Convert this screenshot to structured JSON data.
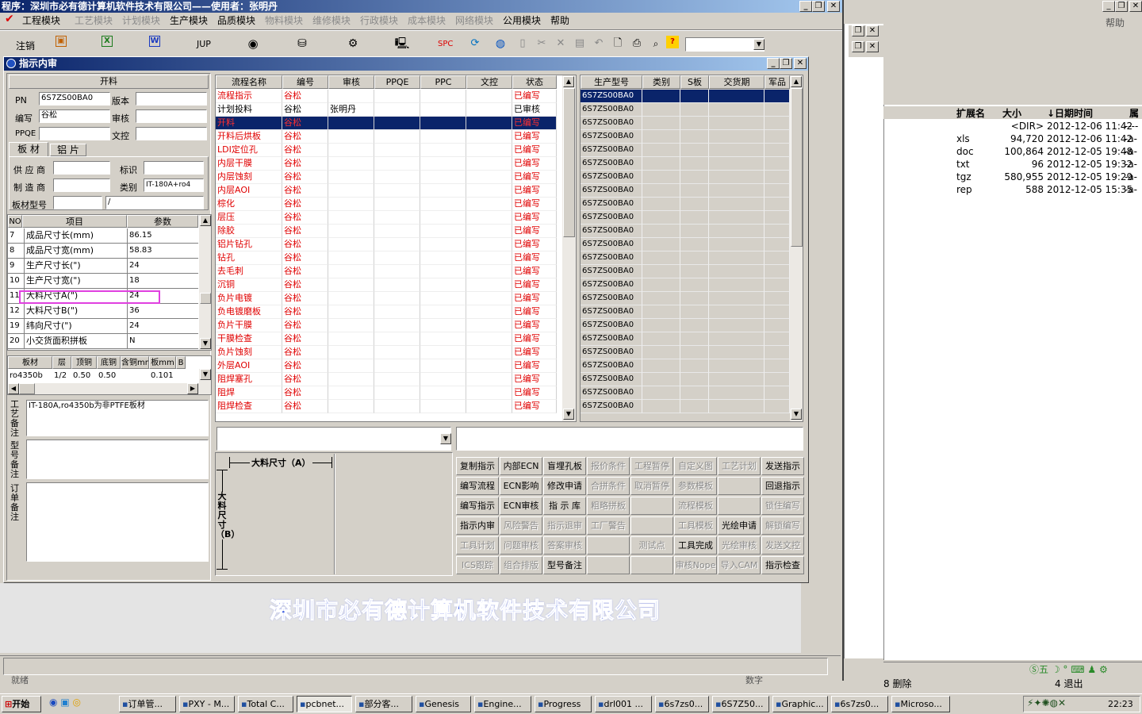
{
  "app": {
    "title": "程序：深圳市必有德计算机软件技术有限公司——使用者：张明丹",
    "menus": [
      {
        "label": "工程模块",
        "enabled": true
      },
      {
        "label": "工艺模块",
        "enabled": false
      },
      {
        "label": "计划模块",
        "enabled": false
      },
      {
        "label": "生产模块",
        "enabled": true
      },
      {
        "label": "品质模块",
        "enabled": true
      },
      {
        "label": "物料模块",
        "enabled": false
      },
      {
        "label": "维修模块",
        "enabled": false
      },
      {
        "label": "行政模块",
        "enabled": false
      },
      {
        "label": "成本模块",
        "enabled": false
      },
      {
        "label": "网络模块",
        "enabled": false
      },
      {
        "label": "公用模块",
        "enabled": true
      },
      {
        "label": "帮助",
        "enabled": true
      }
    ],
    "toolbar": {
      "logout": "注销",
      "jup": "JUP",
      "spc": "SPC"
    },
    "company_banner": "深圳市必有德计算机软件技术有限公司",
    "status_left": "就绪",
    "status_right": "数字"
  },
  "dialog": {
    "title": "指示内审",
    "left": {
      "section_title": "开料",
      "pn_label": "PN",
      "pn_value": "6S7ZS00BA0",
      "version_label": "版本",
      "writer_label": "编写",
      "writer_value": "谷松",
      "review_label": "审核",
      "ppqe_label": "PPQE",
      "control_label": "文控",
      "tabs": [
        "板 材",
        "铝 片"
      ],
      "supplier_label": "供 应 商",
      "mark_label": "标识",
      "maker_label": "制 造 商",
      "category_label": "类别",
      "category_value": "IT-180A+ro4",
      "board_model_label": "板材型号",
      "board_model_value": "/",
      "param_headers": [
        "NO",
        "项目",
        "参数"
      ],
      "params": [
        {
          "no": "7",
          "item": "成品尺寸长(mm)",
          "value": "86.15"
        },
        {
          "no": "8",
          "item": "成品尺寸宽(mm)",
          "value": "58.83"
        },
        {
          "no": "9",
          "item": "生产尺寸长(\")",
          "value": "24"
        },
        {
          "no": "10",
          "item": "生产尺寸宽(\")",
          "value": "18"
        },
        {
          "no": "11",
          "item": "大料尺寸A(\")",
          "value": "24"
        },
        {
          "no": "12",
          "item": "大料尺寸B(\")",
          "value": "36"
        },
        {
          "no": "19",
          "item": "纬向尺寸(\")",
          "value": "24"
        },
        {
          "no": "20",
          "item": "小交货面积拼板",
          "value": "N"
        }
      ],
      "board_headers": [
        "板材",
        "层",
        "顶铜",
        "底铜",
        "含铜mm",
        "板mm",
        "B"
      ],
      "board_row": [
        "ro4350b",
        "1/2",
        "0.50",
        "0.50",
        "",
        "0.101"
      ],
      "remark_labels": [
        "工艺备注",
        "型号备注",
        "订单备注"
      ],
      "process_remark": "IT-180A,ro4350b为非PTFE板材"
    },
    "flow": {
      "headers": [
        "流程名称",
        "编号",
        "审核",
        "PPQE",
        "PPC",
        "文控",
        "状态"
      ],
      "rows": [
        {
          "name": "流程指示",
          "code": "谷松",
          "review": "",
          "status": "已编写",
          "red": true
        },
        {
          "name": "计划投料",
          "code": "谷松",
          "review": "张明丹",
          "status": "已审核",
          "red": false
        },
        {
          "name": "开料",
          "code": "谷松",
          "review": "",
          "status": "已编写",
          "red": true,
          "selected": true
        },
        {
          "name": "开料后烘板",
          "code": "谷松",
          "review": "",
          "status": "已编写",
          "red": true
        },
        {
          "name": "LDI定位孔",
          "code": "谷松",
          "review": "",
          "status": "已编写",
          "red": true
        },
        {
          "name": "内层干膜",
          "code": "谷松",
          "review": "",
          "status": "已编写",
          "red": true
        },
        {
          "name": "内层蚀刻",
          "code": "谷松",
          "review": "",
          "status": "已编写",
          "red": true
        },
        {
          "name": "内层AOI",
          "code": "谷松",
          "review": "",
          "status": "已编写",
          "red": true
        },
        {
          "name": "棕化",
          "code": "谷松",
          "review": "",
          "status": "已编写",
          "red": true
        },
        {
          "name": "层压",
          "code": "谷松",
          "review": "",
          "status": "已编写",
          "red": true
        },
        {
          "name": "除胶",
          "code": "谷松",
          "review": "",
          "status": "已编写",
          "red": true
        },
        {
          "name": "铝片钻孔",
          "code": "谷松",
          "review": "",
          "status": "已编写",
          "red": true
        },
        {
          "name": "钻孔",
          "code": "谷松",
          "review": "",
          "status": "已编写",
          "red": true
        },
        {
          "name": "去毛刺",
          "code": "谷松",
          "review": "",
          "status": "已编写",
          "red": true
        },
        {
          "name": "沉铜",
          "code": "谷松",
          "review": "",
          "status": "已编写",
          "red": true
        },
        {
          "name": "负片电镀",
          "code": "谷松",
          "review": "",
          "status": "已编写",
          "red": true
        },
        {
          "name": "负电镀磨板",
          "code": "谷松",
          "review": "",
          "status": "已编写",
          "red": true
        },
        {
          "name": "负片干膜",
          "code": "谷松",
          "review": "",
          "status": "已编写",
          "red": true
        },
        {
          "name": "干膜检查",
          "code": "谷松",
          "review": "",
          "status": "已编写",
          "red": true
        },
        {
          "name": "负片蚀刻",
          "code": "谷松",
          "review": "",
          "status": "已编写",
          "red": true
        },
        {
          "name": "外层AOI",
          "code": "谷松",
          "review": "",
          "status": "已编写",
          "red": true
        },
        {
          "name": "阻焊塞孔",
          "code": "谷松",
          "review": "",
          "status": "已编写",
          "red": true
        },
        {
          "name": "阻焊",
          "code": "谷松",
          "review": "",
          "status": "已编写",
          "red": true
        },
        {
          "name": "阻焊检查",
          "code": "谷松",
          "review": "",
          "status": "已编写",
          "red": true
        }
      ]
    },
    "model": {
      "headers": [
        "生产型号",
        "类别",
        "S板",
        "交货期",
        "军品"
      ],
      "rows": [
        "6S7ZS00BA0",
        "6S7ZS00BA0",
        "6S7ZS00BA0",
        "6S7ZS00BA0",
        "6S7ZS00BA0",
        "6S7ZS00BA0",
        "6S7ZS00BA0",
        "6S7ZS00BA0",
        "6S7ZS00BA0",
        "6S7ZS00BA0",
        "6S7ZS00BA0",
        "6S7ZS00BA0",
        "6S7ZS00BA0",
        "6S7ZS00BA0",
        "6S7ZS00BA0",
        "6S7ZS00BA0",
        "6S7ZS00BA0",
        "6S7ZS00BA0",
        "6S7ZS00BA0",
        "6S7ZS00BA0",
        "6S7ZS00BA0",
        "6S7ZS00BA0",
        "6S7ZS00BA0",
        "6S7ZS00BA0"
      ]
    },
    "diagram": {
      "a_label": "大料尺寸（A）",
      "b_label": "大料尺寸（B）"
    },
    "actions": [
      [
        "复制指示",
        "内部ECN",
        "盲埋孔板",
        "报价条件",
        "工程暂停",
        "自定义图",
        "工艺计划",
        "发送指示"
      ],
      [
        "编写流程",
        "ECN影响",
        "修改申请",
        "合拼条件",
        "取消暂停",
        "参数模板",
        "",
        "回退指示"
      ],
      [
        "编写指示",
        "ECN审核",
        "指 示 库",
        "粗略拼板",
        "",
        "流程模板",
        "",
        "锁住编写"
      ],
      [
        "指示内审",
        "风险警告",
        "指示退审",
        "工厂警告",
        "",
        "工具模板",
        "光绘申请",
        "解锁编写"
      ],
      [
        "工具计划",
        "问题审核",
        "答案审核",
        "",
        "测试点",
        "工具完成",
        "光绘审核",
        "发送文控"
      ],
      [
        "ICS跟踪",
        "组合排版",
        "型号备注",
        "",
        "",
        "审核Nope",
        "导入CAM",
        "指示检查"
      ]
    ],
    "actions_enabled": [
      [
        1,
        1,
        1,
        0,
        0,
        0,
        0,
        1
      ],
      [
        1,
        1,
        1,
        0,
        0,
        0,
        1,
        1
      ],
      [
        1,
        1,
        1,
        0,
        1,
        0,
        1,
        0
      ],
      [
        1,
        0,
        0,
        0,
        1,
        0,
        1,
        0
      ],
      [
        0,
        0,
        0,
        1,
        0,
        1,
        0,
        0
      ],
      [
        0,
        0,
        1,
        1,
        1,
        0,
        0,
        1
      ]
    ]
  },
  "explorer": {
    "headers": [
      "扩展名",
      "大小",
      "↓日期时间",
      "属"
    ],
    "rows": [
      {
        "ext": "",
        "size": "<DIR>",
        "date": "2012-12-06 11:42",
        "attr": "----"
      },
      {
        "ext": "xls",
        "size": "94,720",
        "date": "2012-12-06 11:42",
        "attr": "-a-"
      },
      {
        "ext": "doc",
        "size": "100,864",
        "date": "2012-12-05 19:48",
        "attr": "-a-"
      },
      {
        "ext": "txt",
        "size": "96",
        "date": "2012-12-05 19:32",
        "attr": "-a-"
      },
      {
        "ext": "tgz",
        "size": "580,955",
        "date": "2012-12-05 19:29",
        "attr": "-a-"
      },
      {
        "ext": "rep",
        "size": "588",
        "date": "2012-12-05 15:35",
        "attr": "-a-"
      }
    ],
    "help": "帮助",
    "delete": "8 删除",
    "exit": "4 退出",
    "ime": "五"
  },
  "taskbar": {
    "start": "开始",
    "items": [
      "订单管...",
      "PXY - M...",
      "Total C...",
      "pcbnet...",
      "部分客...",
      "Genesis",
      "Engine...",
      "Progress",
      "drl001 ...",
      "6s7zs0...",
      "6S7Z50...",
      "Graphic...",
      "6s7zs0...",
      "Microso..."
    ],
    "clock": "22:23"
  }
}
